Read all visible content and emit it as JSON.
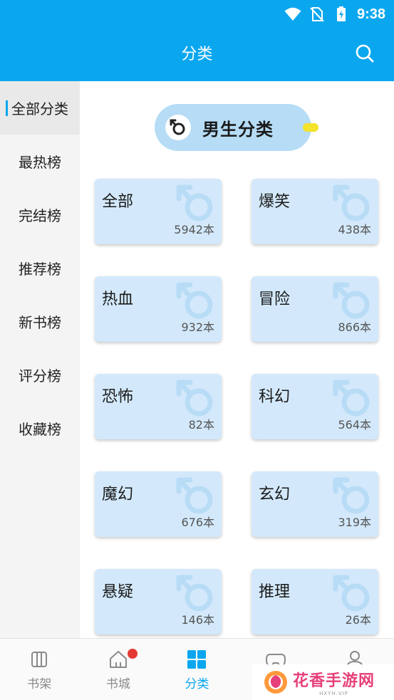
{
  "status_bar": {
    "time": "9:38",
    "icons": [
      "wifi-icon",
      "no-sim-icon",
      "battery-charging-icon"
    ]
  },
  "header": {
    "title": "分类",
    "search_icon": "search-icon"
  },
  "sidebar": {
    "items": [
      {
        "label": "全部分类",
        "active": true
      },
      {
        "label": "最热榜",
        "active": false
      },
      {
        "label": "完结榜",
        "active": false
      },
      {
        "label": "推荐榜",
        "active": false
      },
      {
        "label": "新书榜",
        "active": false
      },
      {
        "label": "评分榜",
        "active": false
      },
      {
        "label": "收藏榜",
        "active": false
      }
    ]
  },
  "gender_pill": {
    "label": "男生分类",
    "icon": "male-symbol-icon"
  },
  "categories": [
    {
      "name": "全部",
      "count": "5942本"
    },
    {
      "name": "爆笑",
      "count": "438本"
    },
    {
      "name": "热血",
      "count": "932本"
    },
    {
      "name": "冒险",
      "count": "866本"
    },
    {
      "name": "恐怖",
      "count": "82本"
    },
    {
      "name": "科幻",
      "count": "564本"
    },
    {
      "name": "魔幻",
      "count": "676本"
    },
    {
      "name": "玄幻",
      "count": "319本"
    },
    {
      "name": "悬疑",
      "count": "146本"
    },
    {
      "name": "推理",
      "count": "26本"
    }
  ],
  "bottom_nav": [
    {
      "label": "书架",
      "icon": "bookshelf-icon",
      "active": false,
      "badge": false
    },
    {
      "label": "书城",
      "icon": "home-icon",
      "active": false,
      "badge": true
    },
    {
      "label": "分类",
      "icon": "category-grid-icon",
      "active": true,
      "badge": false
    },
    {
      "label": "",
      "icon": "gamepad-icon",
      "active": false,
      "badge": false
    },
    {
      "label": "",
      "icon": "person-icon",
      "active": false,
      "badge": false
    }
  ],
  "watermark": {
    "main": "花香手游网",
    "sub": "HXYH.VIP"
  },
  "colors": {
    "accent": "#0aa7ef",
    "card_bg": "#d3e9fb",
    "pill_bg": "#b6dcf6",
    "badge": "#e53935"
  }
}
